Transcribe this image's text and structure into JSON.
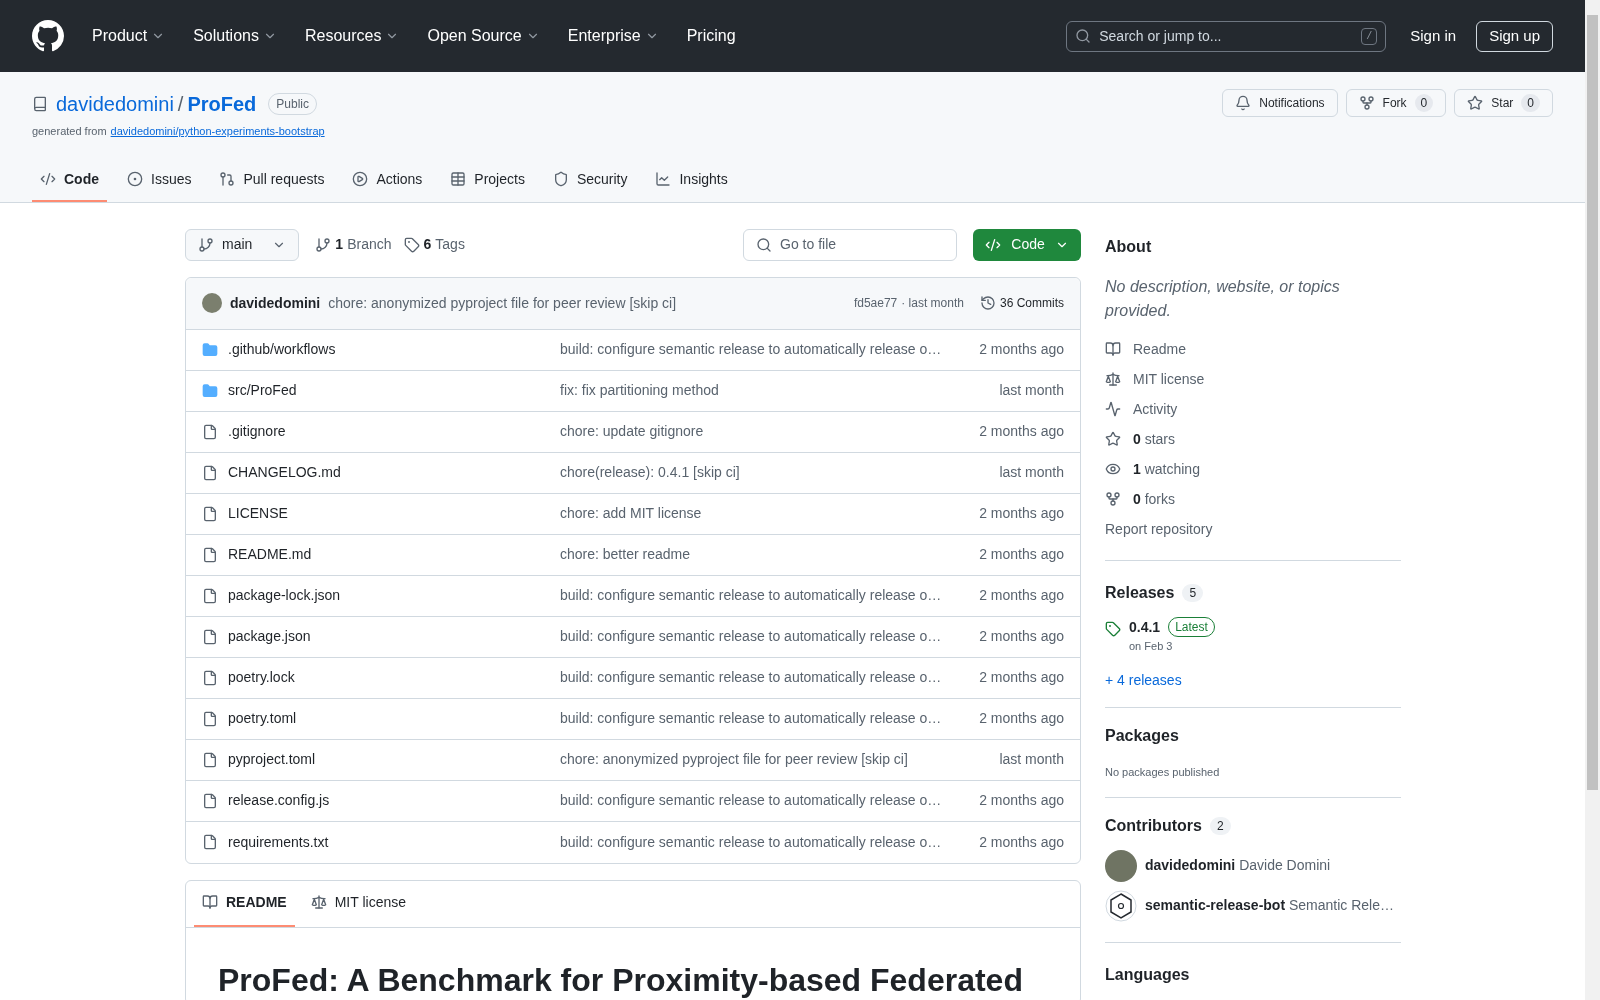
{
  "header": {
    "nav": [
      {
        "label": "Product",
        "dropdown": true
      },
      {
        "label": "Solutions",
        "dropdown": true
      },
      {
        "label": "Resources",
        "dropdown": true
      },
      {
        "label": "Open Source",
        "dropdown": true
      },
      {
        "label": "Enterprise",
        "dropdown": true
      },
      {
        "label": "Pricing",
        "dropdown": false
      }
    ],
    "search": {
      "placeholder": "Search or jump to...",
      "shortcut": "/"
    },
    "sign_in": "Sign in",
    "sign_up": "Sign up"
  },
  "repo": {
    "owner": "davidedomini",
    "separator": "/",
    "name": "ProFed",
    "visibility": "Public",
    "generated_label": "generated from",
    "template": "davidedomini/python-experiments-bootstrap",
    "actions": [
      {
        "kind": "notifications",
        "label": "Notifications"
      },
      {
        "kind": "fork",
        "label": "Fork",
        "count": "0"
      },
      {
        "kind": "star",
        "label": "Star",
        "count": "0"
      }
    ]
  },
  "tabs": [
    {
      "label": "Code",
      "selected": true
    },
    {
      "label": "Issues",
      "selected": false
    },
    {
      "label": "Pull requests",
      "selected": false
    },
    {
      "label": "Actions",
      "selected": false
    },
    {
      "label": "Projects",
      "selected": false
    },
    {
      "label": "Security",
      "selected": false
    },
    {
      "label": "Insights",
      "selected": false
    }
  ],
  "toolbar": {
    "branch": "main",
    "branches_count": "1",
    "branches_label": "Branch",
    "tags_count": "6",
    "tags_label": "Tags",
    "go_to_file": "Go to file",
    "code_button": "Code"
  },
  "latest_commit": {
    "author": "davidedomini",
    "message": "chore: anonymized pyproject file for peer review [skip ci]",
    "hash": "fd5ae77",
    "time": "· last month",
    "commits": "36 Commits"
  },
  "files": [
    {
      "kind": "folder",
      "name": ".github/workflows",
      "message": "build: configure semantic release to automatically release o…",
      "time": "2 months ago"
    },
    {
      "kind": "folder",
      "name": "src/ProFed",
      "message": "fix: fix partitioning method",
      "time": "last month"
    },
    {
      "kind": "file",
      "name": ".gitignore",
      "message": "chore: update gitignore",
      "time": "2 months ago"
    },
    {
      "kind": "file",
      "name": "CHANGELOG.md",
      "message": "chore(release): 0.4.1 [skip ci]",
      "time": "last month"
    },
    {
      "kind": "file",
      "name": "LICENSE",
      "message": "chore: add MIT license",
      "time": "2 months ago"
    },
    {
      "kind": "file",
      "name": "README.md",
      "message": "chore: better readme",
      "time": "2 months ago"
    },
    {
      "kind": "file",
      "name": "package-lock.json",
      "message": "build: configure semantic release to automatically release o…",
      "time": "2 months ago"
    },
    {
      "kind": "file",
      "name": "package.json",
      "message": "build: configure semantic release to automatically release o…",
      "time": "2 months ago"
    },
    {
      "kind": "file",
      "name": "poetry.lock",
      "message": "build: configure semantic release to automatically release o…",
      "time": "2 months ago"
    },
    {
      "kind": "file",
      "name": "poetry.toml",
      "message": "build: configure semantic release to automatically release o…",
      "time": "2 months ago"
    },
    {
      "kind": "file",
      "name": "pyproject.toml",
      "message": "chore: anonymized pyproject file for peer review [skip ci]",
      "time": "last month"
    },
    {
      "kind": "file",
      "name": "release.config.js",
      "message": "build: configure semantic release to automatically release o…",
      "time": "2 months ago"
    },
    {
      "kind": "file",
      "name": "requirements.txt",
      "message": "build: configure semantic release to automatically release o…",
      "time": "2 months ago"
    }
  ],
  "readme_tabs": [
    {
      "label": "README",
      "selected": true
    },
    {
      "label": "MIT license",
      "selected": false
    }
  ],
  "readme_heading": "ProFed: A Benchmark for Proximity-based Federated",
  "about": {
    "title": "About",
    "description": "No description, website, or topics provided.",
    "links": [
      {
        "label": "Readme"
      },
      {
        "label": "MIT license"
      },
      {
        "label": "Activity"
      },
      {
        "count": "0",
        "label": "stars"
      },
      {
        "count": "1",
        "label": "watching"
      },
      {
        "count": "0",
        "label": "forks"
      }
    ],
    "report": "Report repository"
  },
  "releases": {
    "title": "Releases",
    "count": "5",
    "latest": {
      "version": "0.4.1",
      "badge": "Latest",
      "date": "on Feb 3"
    },
    "more": "+ 4 releases"
  },
  "packages": {
    "title": "Packages",
    "empty": "No packages published"
  },
  "contributors": {
    "title": "Contributors",
    "count": "2",
    "people": [
      {
        "kind": "photo",
        "login": "davidedomini",
        "name": "Davide Domini"
      },
      {
        "kind": "bot",
        "login": "semantic-release-bot",
        "name": "Semantic Rele…"
      }
    ]
  },
  "languages": {
    "title": "Languages"
  }
}
